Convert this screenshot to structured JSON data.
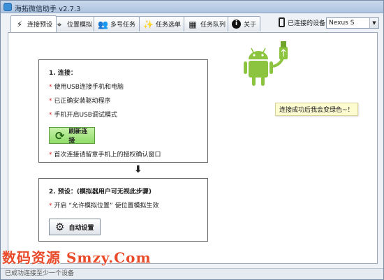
{
  "window": {
    "title": "海拓微信助手 v2.7.3",
    "min_label": "–",
    "max_label": "□",
    "close_label": "✕"
  },
  "tabs": [
    {
      "label": "连接预设",
      "icon": "lightning-icon",
      "active": true
    },
    {
      "label": "位置模拟",
      "icon": "crosshair-icon",
      "active": false
    },
    {
      "label": "多号任务",
      "icon": "users-icon",
      "active": false
    },
    {
      "label": "任务选单",
      "icon": "magic-wand-icon",
      "active": false
    },
    {
      "label": "任务队列",
      "icon": "grid-icon",
      "active": false
    },
    {
      "label": "关于",
      "icon": "info-icon",
      "active": false
    }
  ],
  "device": {
    "label": "已连接的设备",
    "selected": "Nexus S"
  },
  "step1": {
    "title": "1. 连接：",
    "items": [
      "使用USB连接手机和电脑",
      "已正确安装驱动程序",
      "手机开启USB调试模式"
    ],
    "refresh_label": "刷新连接",
    "note": "首次连接请留意手机上的授权确认窗口",
    "star": "*"
  },
  "arrow": "⬇",
  "step2": {
    "title": "2. 预设：(模拟器用户可无视此步骤)",
    "item": "开启 “允许模拟位置” 使位置模拟生效",
    "auto_label": "自动设置",
    "star": "*"
  },
  "tooltip": "连接成功后我会变绿色~！",
  "watermark": "数码资源 Smzy.Com",
  "status": "已成功连接至少一个设备",
  "colors": {
    "android_green": "#8cc43f",
    "refresh_green": "#8fdc6a",
    "tooltip_bg": "#fdfbd0",
    "watermark": "#e84a2a"
  }
}
